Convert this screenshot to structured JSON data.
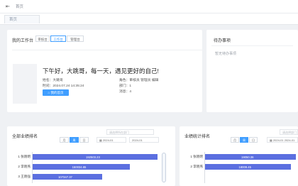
{
  "topbar": {
    "back_icon": "back-arrow-icon",
    "breadcrumb": "首页"
  },
  "tabs": [
    {
      "label": "首页"
    }
  ],
  "workbench": {
    "title": "我的工作台",
    "toggles": [
      {
        "label": "审核台",
        "active": false
      },
      {
        "label": "工作台",
        "active": true
      },
      {
        "label": "管理台",
        "active": false
      }
    ],
    "greeting": "下午好，大跳哥，每一天，遇见更好的自己!",
    "name": "姓名：大跳哥",
    "login_time": "时间：2024.07.24 14:35:24",
    "role": "角色：审核员 管理员 编辑",
    "department": "部门：1",
    "messages": "消息：4",
    "button": "我的首页",
    "accent": "#409eff"
  },
  "todo": {
    "title": "待办事项",
    "empty": "暂无待办事项"
  },
  "ranking_left": {
    "title": "全部业绩排名",
    "select_placeholder": "请选择所在部门",
    "periods": [
      {
        "label": "月",
        "active": false
      },
      {
        "label": "周",
        "active": true
      },
      {
        "label": "日",
        "active": false
      }
    ],
    "date_start": "2024-01",
    "date_end": "2024-01",
    "rows": [
      {
        "label": "1 张晓明"
      },
      {
        "label": "2 李晓燕"
      },
      {
        "label": "3 王晓强"
      }
    ]
  },
  "ranking_right": {
    "title": "业绩统计排名",
    "select_placeholder": "请选择部门",
    "periods": [
      {
        "label": "月",
        "active": false
      },
      {
        "label": "周",
        "active": true
      },
      {
        "label": "日",
        "active": false
      }
    ],
    "date_start": "2024-01",
    "date_end": "2024-01",
    "rows": [
      {
        "label": "1 张晓明"
      },
      {
        "label": "2 李晓燕"
      }
    ]
  },
  "chart_data": [
    {
      "type": "bar",
      "orientation": "horizontal",
      "categories": [
        "1 张晓明",
        "2 李晓燕",
        "3 王晓强"
      ],
      "values": [
        192503.23,
        150034.65,
        107347.37
      ],
      "labels": [
        "192503.23",
        "150034.65",
        "107347.37"
      ],
      "xlim": [
        0,
        192503.23
      ]
    },
    {
      "type": "bar",
      "orientation": "horizontal",
      "categories": [
        "1 张晓明",
        "2 李晓燕"
      ],
      "values": [
        19050.36,
        18009.45
      ],
      "labels": [
        "19050.36",
        "18009.45"
      ],
      "xlim": [
        0,
        19050.36
      ]
    }
  ]
}
